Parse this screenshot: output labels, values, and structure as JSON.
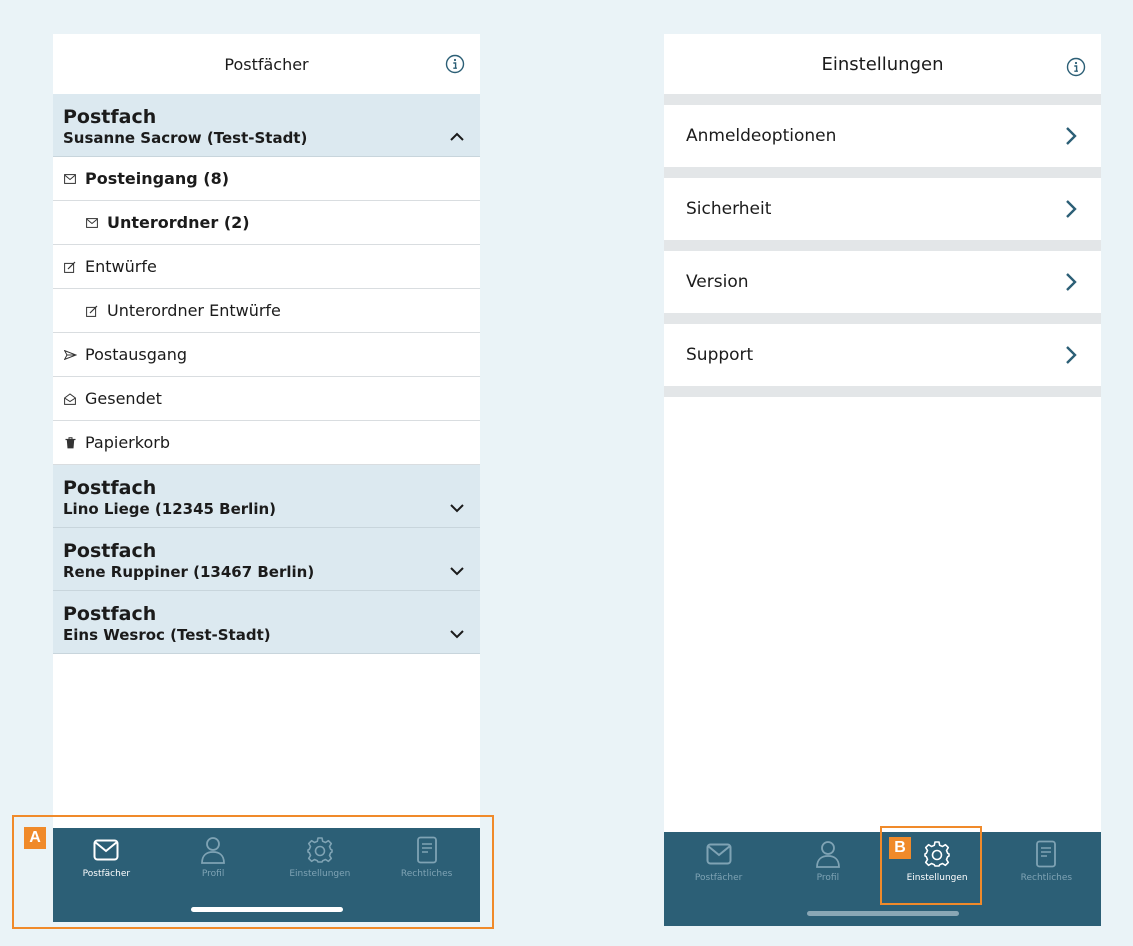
{
  "left": {
    "title": "Postfächer",
    "expanded_mailbox": {
      "heading": "Postfach",
      "owner": "Susanne Sacrow (Test-Stadt)",
      "folders": [
        {
          "label": "Posteingang (8)",
          "icon": "envelope-icon"
        },
        {
          "label": "Unterordner (2)",
          "icon": "envelope-icon"
        },
        {
          "label": "Entwürfe",
          "icon": "edit-icon"
        },
        {
          "label": "Unterordner Entwürfe",
          "icon": "edit-icon"
        },
        {
          "label": "Postausgang",
          "icon": "send-icon"
        },
        {
          "label": "Gesendet",
          "icon": "open-envelope-icon"
        },
        {
          "label": "Papierkorb",
          "icon": "trash-icon"
        }
      ]
    },
    "collapsed_mailboxes": [
      {
        "heading": "Postfach",
        "owner": "Lino Liege (12345 Berlin)"
      },
      {
        "heading": "Postfach",
        "owner": "Rene Ruppiner (13467 Berlin)"
      },
      {
        "heading": "Postfach",
        "owner": "Eins Wesroc (Test-Stadt)"
      }
    ]
  },
  "right": {
    "title": "Einstellungen",
    "items": [
      "Anmeldeoptionen",
      "Sicherheit",
      "Version",
      "Support"
    ]
  },
  "tabs": [
    "Postfächer",
    "Profil",
    "Einstellungen",
    "Rechtliches"
  ],
  "callouts": {
    "a": "A",
    "b": "B"
  },
  "colors": {
    "accent": "#2c5f76",
    "mailbox_header_bg": "#dce9f0",
    "callout": "#f08a2a",
    "page_bg": "#eaf3f7"
  }
}
